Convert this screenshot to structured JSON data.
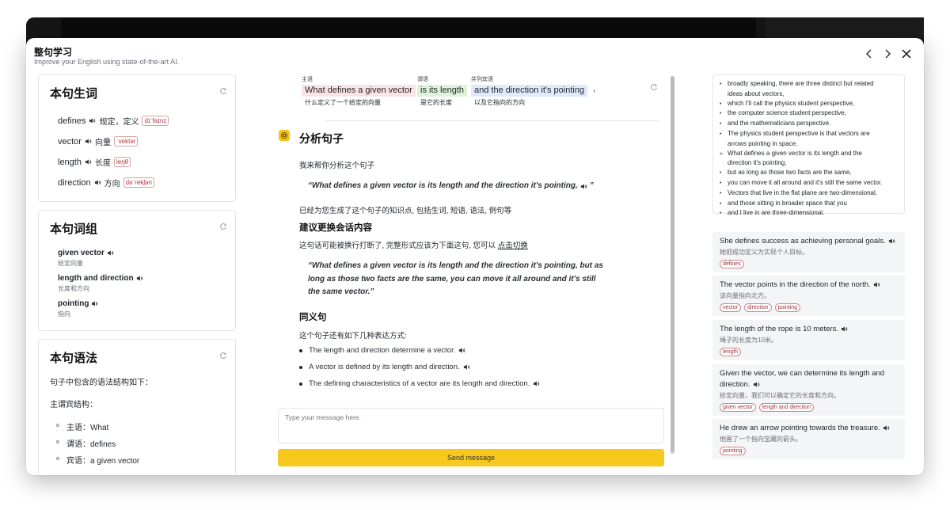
{
  "modal": {
    "title": "整句学习",
    "subtitle": "Improve your English using state-of-the-art AI."
  },
  "vocab": {
    "title": "本句生词",
    "words": [
      {
        "word": "defines",
        "zh": "规定，定义",
        "phonetic": "dɪˈfaɪnz"
      },
      {
        "word": "vector",
        "zh": "向量",
        "phonetic": "ˈvektər"
      },
      {
        "word": "length",
        "zh": "长度",
        "phonetic": "leŋθ"
      },
      {
        "word": "direction",
        "zh": "方向",
        "phonetic": "dəˈrekʃən"
      }
    ]
  },
  "phrases": {
    "title": "本句词组",
    "items": [
      {
        "phrase": "given vector",
        "zh": "给定向量"
      },
      {
        "phrase": "length and direction",
        "zh": "长度和方向"
      },
      {
        "phrase": "pointing",
        "zh": "指向"
      }
    ]
  },
  "grammar": {
    "title": "本句语法",
    "intro": "句子中包含的语法结构如下：",
    "structure": "主谓宾结构：",
    "items": [
      "主语：What",
      "谓语：defines",
      "宾语：a given vector"
    ]
  },
  "sentence": {
    "segments": [
      {
        "role": "主语",
        "text": "What defines a given vector",
        "translation": "什么定义了一个给定的向量",
        "color": "#fbe3e4"
      },
      {
        "role": "谓语",
        "text": "is its length",
        "translation": "是它的长度",
        "color": "#dff3dc"
      },
      {
        "role": "并列宾语",
        "text": "and the direction it's pointing",
        "translation": "以及它指向的方向",
        "color": "#dfeafb"
      }
    ],
    "trailing": ","
  },
  "analysis": {
    "heading": "分析句子",
    "intro": "我来帮你分析这个句子",
    "quote1": "“What defines a given vector is its length and the direction it's pointing,",
    "quote1_end": "”",
    "generated": "已经为您生成了这个句子的知识点, 包括生词, 短语, 语法, 例句等",
    "suggest_heading": "建议更换会话内容",
    "suggest_text": "这句话可能被换行打断了, 完整形式应该为下面这句, 您可以",
    "suggest_link": "点击切换",
    "quote2": "“What defines a given vector is its length and the direction it's pointing, but as long as those two facts are the same, you can move it all around and it's still the same vector.”",
    "syn_heading": "同义句",
    "syn_intro": "这个句子还有如下几种表达方式:",
    "synonyms": [
      "The length and direction determine a vector.",
      "A vector is defined by its length and direction.",
      "The defining characteristics of a vector are its length and direction."
    ]
  },
  "chat": {
    "placeholder": "Type your message here.",
    "send_label": "Send message"
  },
  "passage": {
    "lines": [
      {
        "bullet": "•",
        "text": "broadly speaking, there are three distinct but related"
      },
      {
        "bullet": "",
        "text": "ideas about vectors,"
      },
      {
        "bullet": "•",
        "text": "which I'll call the physics student perspective,"
      },
      {
        "bullet": "•",
        "text": "the computer science student perspective,"
      },
      {
        "bullet": "•",
        "text": "and the mathematicians perspective."
      },
      {
        "bullet": "•",
        "text": "The physics student perspective is that vectors are"
      },
      {
        "bullet": "",
        "text": "arrows pointing in space."
      },
      {
        "bullet": "»",
        "text": "What defines a given vector is its length and the"
      },
      {
        "bullet": "",
        "text": "direction it's pointing,"
      },
      {
        "bullet": "•",
        "text": "but as long as those two facts are the same,"
      },
      {
        "bullet": "•",
        "text": "you can move it all around and it's still the same vector."
      },
      {
        "bullet": "•",
        "text": "Vectors that live in the flat plane are two-dimensional,"
      },
      {
        "bullet": "•",
        "text": "and those sitting in broader space that you"
      },
      {
        "bullet": "•",
        "text": "and I live in are three-dimensional."
      }
    ]
  },
  "examples": [
    {
      "en": "She defines success as achieving personal goals.",
      "zh": "她把成功定义为实现个人目标。",
      "tags": [
        "defines"
      ]
    },
    {
      "en": "The vector points in the direction of the north.",
      "zh": "该向量指向北方。",
      "tags": [
        "vector",
        "direction",
        "pointing"
      ]
    },
    {
      "en": "The length of the rope is 10 meters.",
      "zh": "绳子的长度为10米。",
      "tags": [
        "length"
      ]
    },
    {
      "en": "Given the vector, we can determine its length and direction.",
      "zh": "给定向量，我们可以确定它的长度和方向。",
      "tags": [
        "given vector",
        "length and direction"
      ]
    },
    {
      "en": "He drew an arrow pointing towards the treasure.",
      "zh": "他画了一个指向宝藏的箭头。",
      "tags": [
        "pointing"
      ]
    }
  ]
}
